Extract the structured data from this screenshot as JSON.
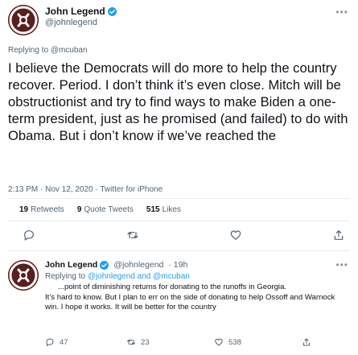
{
  "tweet": {
    "author_name": "John Legend",
    "author_handle": "@johnlegend",
    "more_glyph": "•••",
    "replying_prefix": "Replying to ",
    "replying_to": "@mcuban",
    "text": "I believe the Democrats will do more to help the country recover. Period. I don’t think it’s even close. Mitch will be obstructionist and try to find ways to make Biden a one-term president, just as he promised (and failed) to do with Obama. But i don’t know if we’ve reached the",
    "timestamp": "2:13 PM · Nov 12, 2020 · Twitter for iPhone",
    "stats": {
      "retweets_count": "19",
      "retweets_label": "Retweets",
      "quote_count": "9",
      "quote_label": "Quote Tweets",
      "likes_count": "515",
      "likes_label": "Likes"
    }
  },
  "reply": {
    "author_name": "John Legend",
    "author_handle": "@johnlegend",
    "time": "· 19h",
    "more_glyph": "•••",
    "replying_prefix": "Replying to ",
    "replying_to": "@johnlegend and @mcuban",
    "text_first": "...point of diminishing returns for donating to the runoffs in Georgia.",
    "text_rest": "It’s hard to know. But I plan to err on the side of donating to help Ossoff and Warnock win.  I hope it works. It will be better for the country",
    "reply_count": "47",
    "retweet_count": "23",
    "like_count": "538"
  },
  "colors": {
    "verified": "#1da1f2",
    "text": "#0f1419",
    "secondary": "#536471",
    "divider": "#e6ecf0"
  },
  "icons": [
    "verified-badge-icon",
    "reply-icon",
    "retweet-icon",
    "like-icon",
    "share-icon",
    "more-icon"
  ]
}
